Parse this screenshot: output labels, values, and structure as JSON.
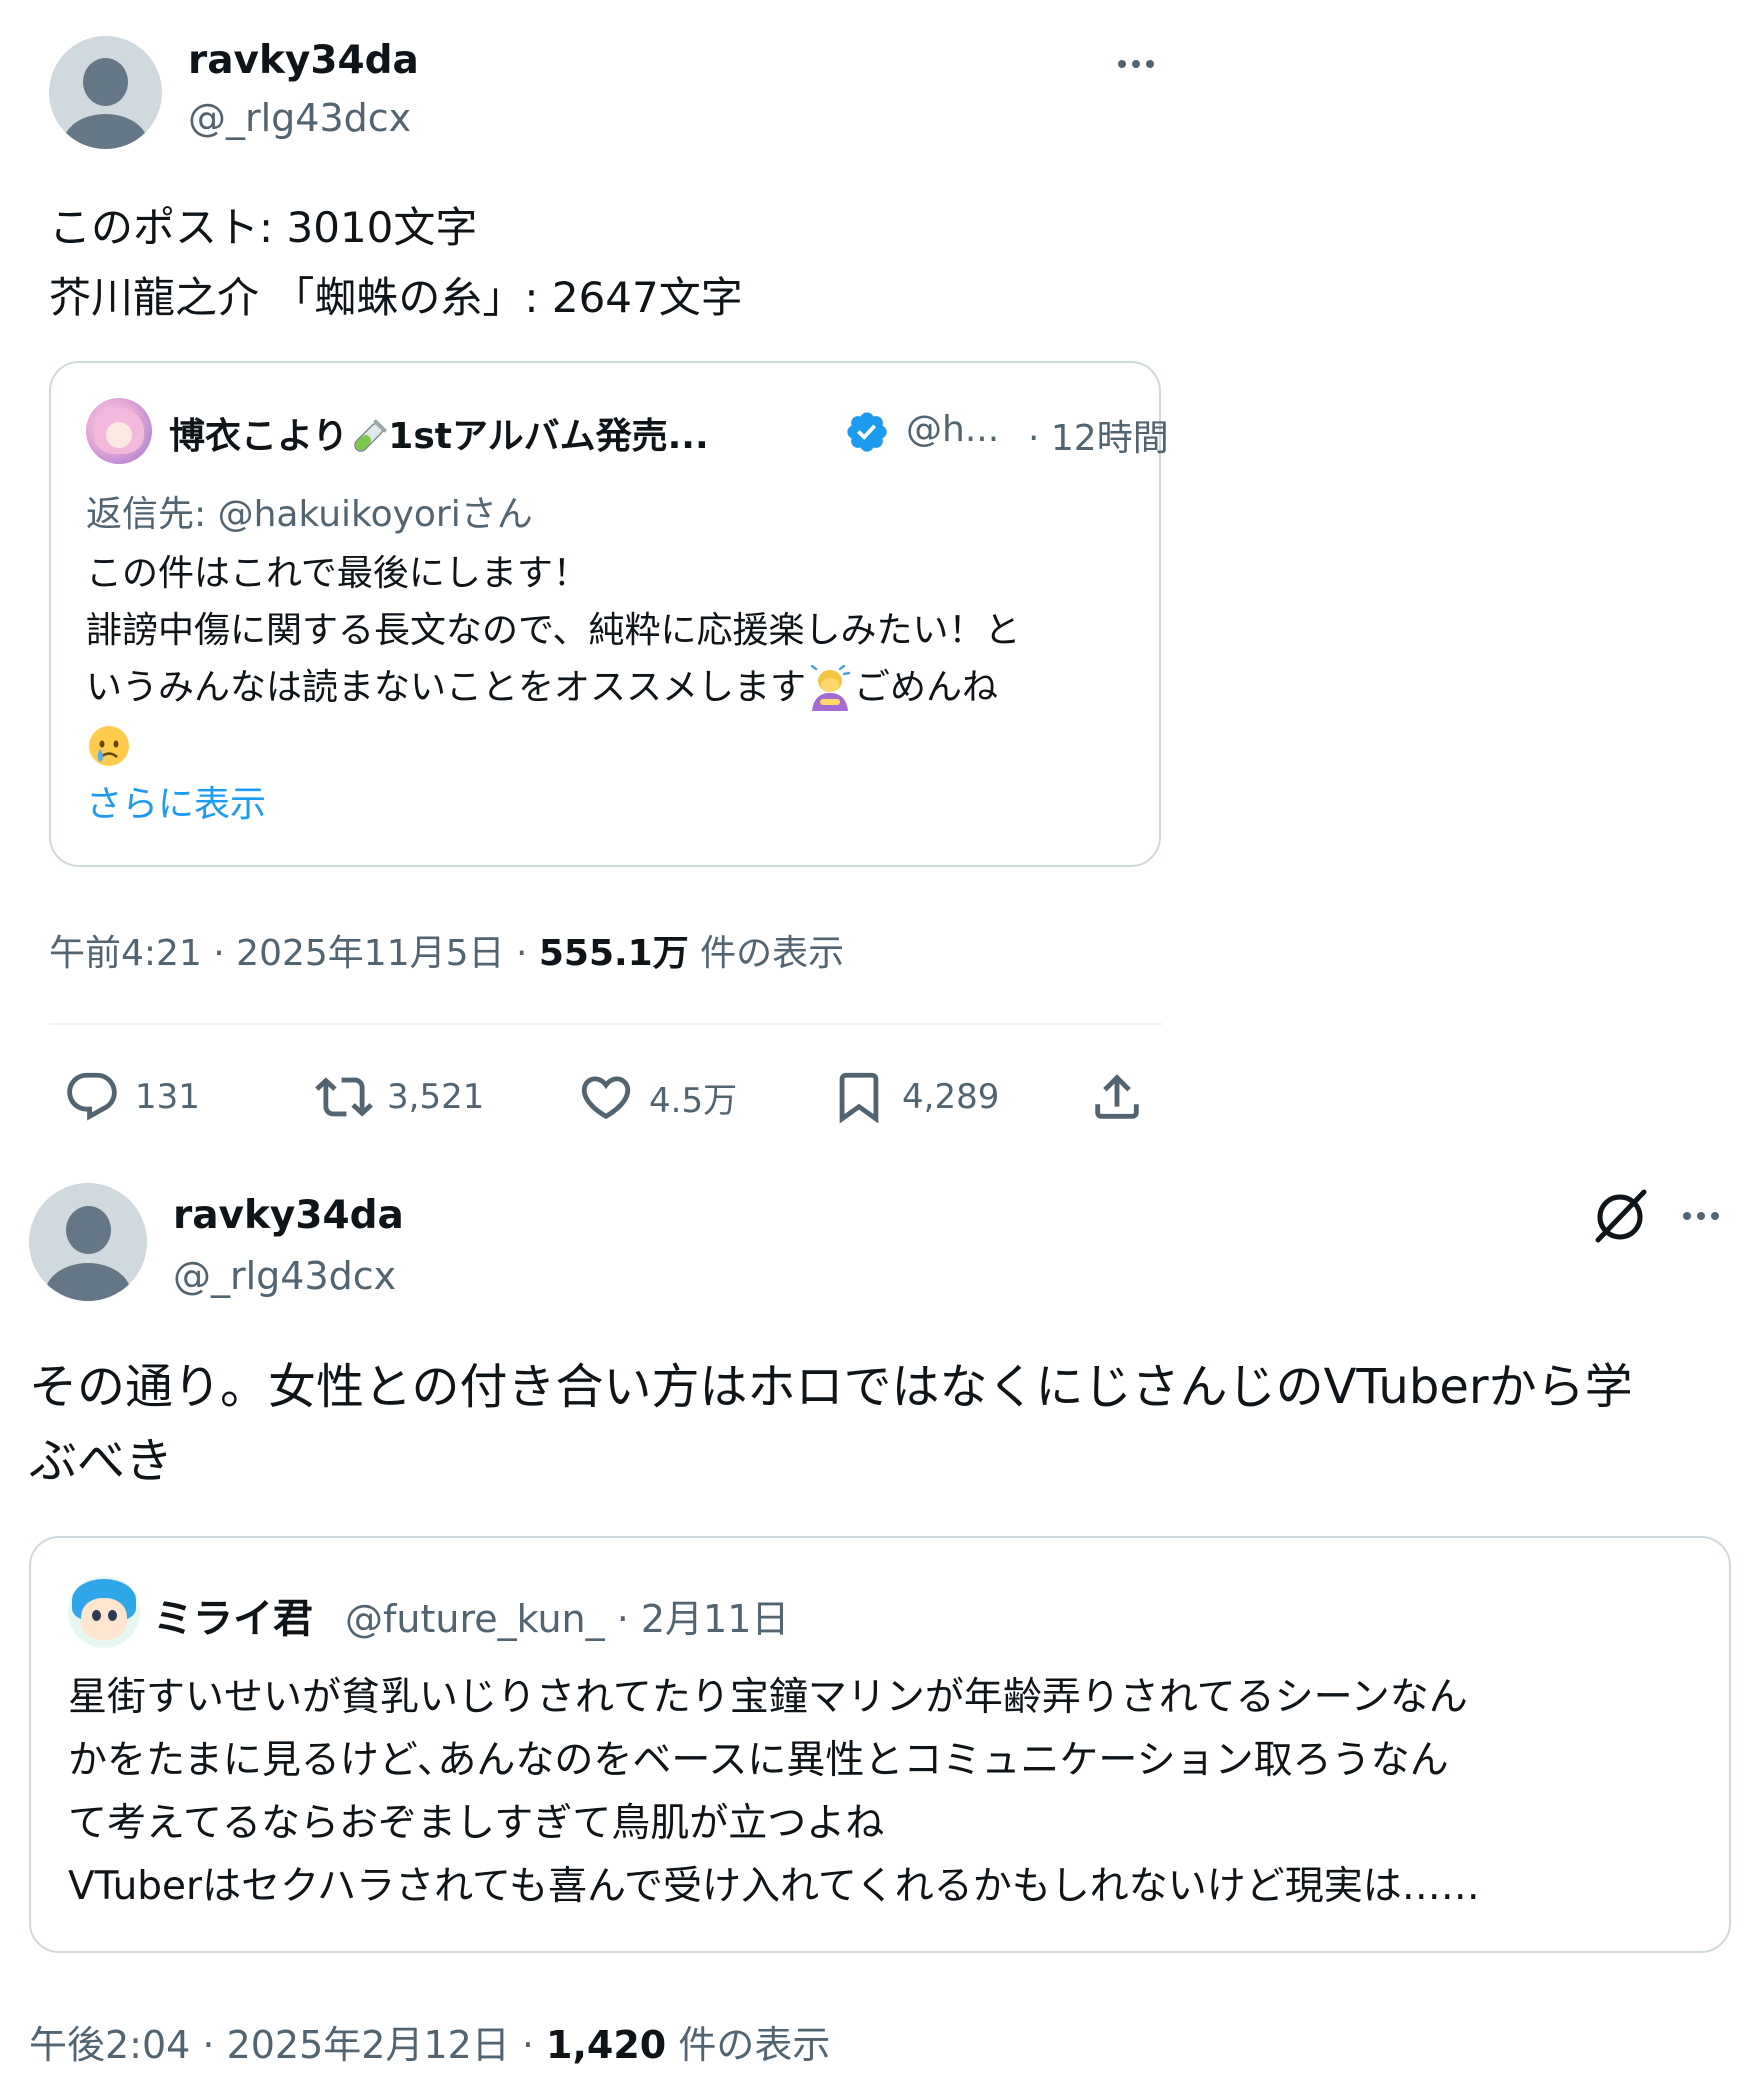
{
  "post1": {
    "display_name": "ravky34da",
    "handle": "@_rlg43dcx",
    "text_lines": [
      "このポスト: 3010文字",
      "芥川龍之介 「蜘蛛の糸」: 2647文字"
    ],
    "quote": {
      "name": "博衣こより",
      "name_suffix": "1stアルバム発売...",
      "handle": "@h...",
      "time": "· 12時間",
      "reply_to": "返信先: @hakuikoyoriさん",
      "lines": [
        "この件はこれで最後にします！",
        "誹謗中傷に関する長文なので、純粋に応援楽しみたい！と",
        "いうみんなは読まないことをオススメします",
        "ごめんね"
      ],
      "show_more": "さらに表示"
    },
    "timestamp": {
      "prefix": "午前4:21 · 2025年11月5日 · ",
      "views": "555.1万",
      "suffix": " 件の表示"
    },
    "actions": {
      "replies": "131",
      "reposts": "3,521",
      "likes": "4.5万",
      "bookmarks": "4,289"
    }
  },
  "post2": {
    "display_name": "ravky34da",
    "handle": "@_rlg43dcx",
    "text_lines": [
      "その通り。女性との付き合い方はホロではなくにじさんじのVTuberから学",
      "ぶべき"
    ],
    "quote": {
      "name": "ミライ君",
      "handle": "@future_kun_ · 2月11日",
      "lines": [
        "星街すいせいが貧乳いじりされてたり宝鐘マリンが年齢弄りされてるシーンなん",
        "かをたまに見るけど､あんなのをベースに異性とコミュニケーション取ろうなん",
        "て考えてるならおぞましすぎて鳥肌が立つよね",
        "VTuberはセクハラされても喜んで受け入れてくれるかもしれないけど現実は……"
      ]
    },
    "timestamp": {
      "prefix": "午後2:04 · 2025年2月12日 · ",
      "views": "1,420",
      "suffix": " 件の表示"
    }
  },
  "colors": {
    "text_primary": "#0f1419",
    "text_secondary": "#536471",
    "link_blue": "#1d9bf0",
    "border": "#cfd9de"
  },
  "icons": [
    "more-icon",
    "verified-badge-icon",
    "test-tube-emoji",
    "reply-icon",
    "repost-icon",
    "like-icon",
    "bookmark-icon",
    "share-icon",
    "grok-icon",
    "bowing-emoji",
    "crying-emoji"
  ]
}
